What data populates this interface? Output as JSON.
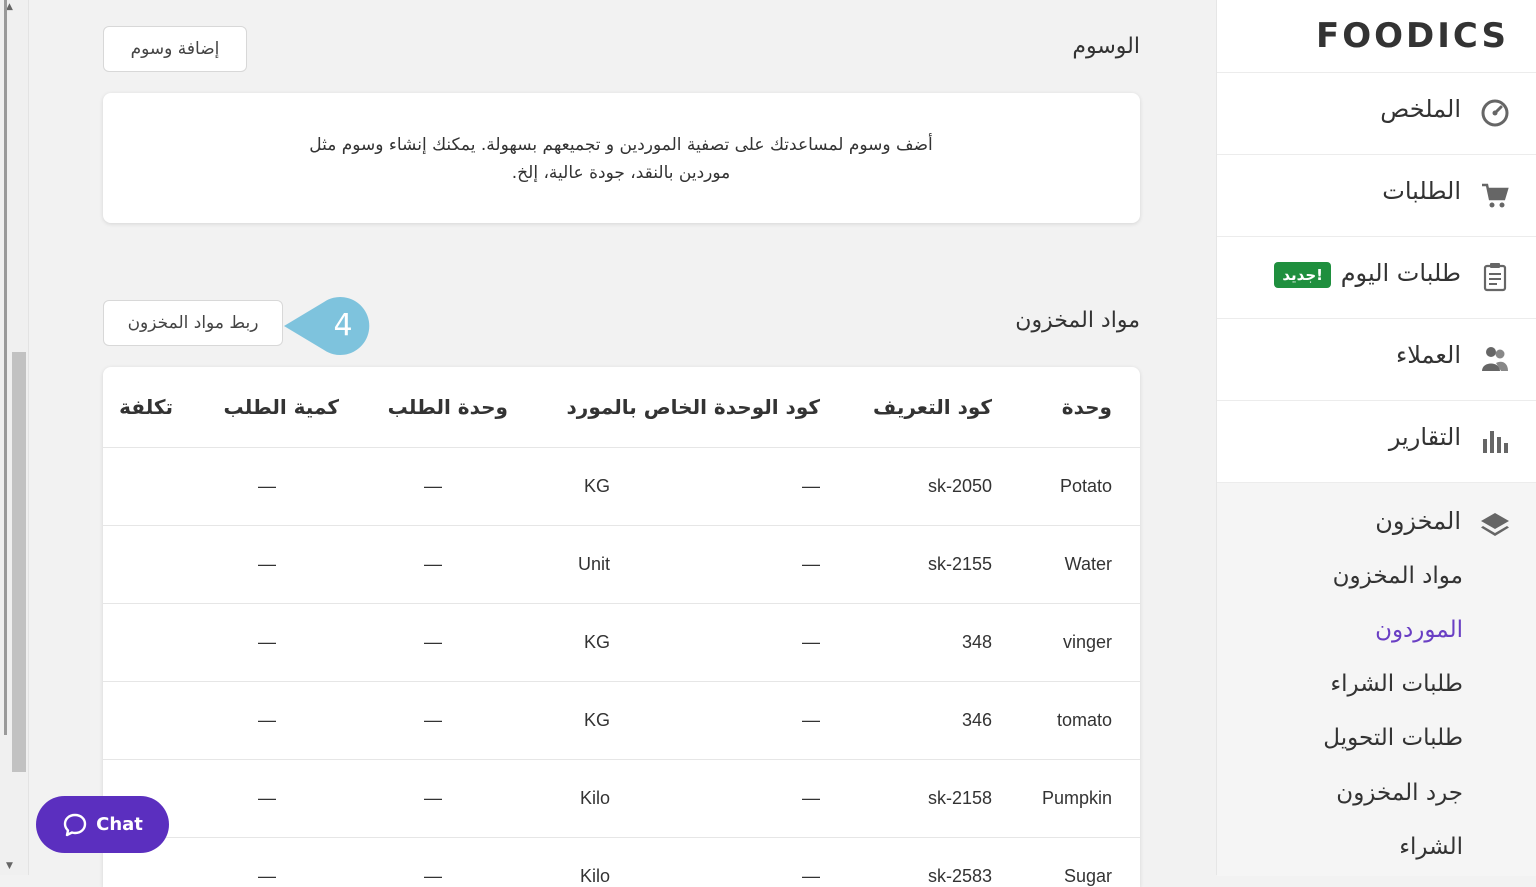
{
  "brand": {
    "logo": "FOODICS"
  },
  "sidebar": {
    "items": [
      {
        "label": "الملخص",
        "icon": "dashboard-gauge-icon"
      },
      {
        "label": "الطلبات",
        "icon": "cart-icon"
      },
      {
        "label": "طلبات اليوم",
        "icon": "clipboard-icon",
        "badge": "جديد!"
      },
      {
        "label": "العملاء",
        "icon": "customers-icon"
      },
      {
        "label": "التقارير",
        "icon": "bar-chart-icon"
      }
    ],
    "inventory": {
      "label": "المخزون",
      "icon": "layers-icon",
      "sub_items": [
        "مواد المخزون",
        "الموردون",
        "طلبات الشراء",
        "طلبات التحويل",
        "جرد المخزون",
        "الشراء"
      ],
      "active_index": 1
    }
  },
  "tags_section": {
    "title": "الوسوم",
    "add_button": "إضافة وسوم",
    "description_line1": "أضف وسوم لمساعدتك على تصفية الموردين و تجميعهم بسهولة. يمكنك إنشاء وسوم مثل",
    "description_line2": "موردين بالنقد، جودة عالية، إلخ."
  },
  "inventory_section": {
    "title": "مواد المخزون",
    "link_button": "ربط مواد المخزون",
    "step_marker": "4"
  },
  "table": {
    "headers": {
      "unit": "وحدة",
      "sku": "كود التعريف",
      "supplier_code": "كود الوحدة الخاص بالمورد",
      "order_unit": "وحدة الطلب",
      "order_qty": "كمية الطلب",
      "cost": "تكلفة"
    },
    "rows": [
      {
        "name": "Potato",
        "sku": "sk-2050",
        "supplier_code": "—",
        "order_unit": "KG",
        "order_qty": "—",
        "cost": "—"
      },
      {
        "name": "Water",
        "sku": "sk-2155",
        "supplier_code": "—",
        "order_unit": "Unit",
        "order_qty": "—",
        "cost": "—"
      },
      {
        "name": "vinger",
        "sku": "348",
        "supplier_code": "—",
        "order_unit": "KG",
        "order_qty": "—",
        "cost": "—"
      },
      {
        "name": "tomato",
        "sku": "346",
        "supplier_code": "—",
        "order_unit": "KG",
        "order_qty": "—",
        "cost": "—"
      },
      {
        "name": "Pumpkin",
        "sku": "sk-2158",
        "supplier_code": "—",
        "order_unit": "Kilo",
        "order_qty": "—",
        "cost": "—"
      },
      {
        "name": "Sugar",
        "sku": "sk-2583",
        "supplier_code": "—",
        "order_unit": "Kilo",
        "order_qty": "—",
        "cost": "—"
      }
    ]
  },
  "chat": {
    "label": "Chat"
  },
  "colors": {
    "accent": "#6a3fc4",
    "badge": "#1f8f3e",
    "chat": "#5b2fbf",
    "marker": "#7ec3dd"
  }
}
